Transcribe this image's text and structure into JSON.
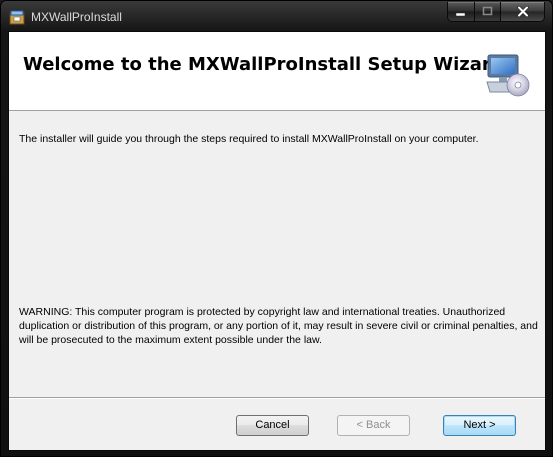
{
  "window": {
    "title": "MXWallProInstall"
  },
  "banner": {
    "title": "Welcome to the MXWallProInstall Setup Wizard",
    "icon": "setup-computer-cd-icon"
  },
  "body": {
    "intro": "The installer will guide you through the steps required to install MXWallProInstall on your computer.",
    "warning": "WARNING: This computer program is protected by copyright law and international treaties. Unauthorized duplication or distribution of this program, or any portion of it, may result in severe civil or criminal penalties, and will be prosecuted to the maximum extent possible under the law."
  },
  "buttons": {
    "cancel": "Cancel",
    "back": "< Back",
    "next": "Next >"
  },
  "colors": {
    "titlebar": "#1a1a1a",
    "client_background": "#f0f0f0",
    "next_button_border": "#3c7fb1"
  }
}
